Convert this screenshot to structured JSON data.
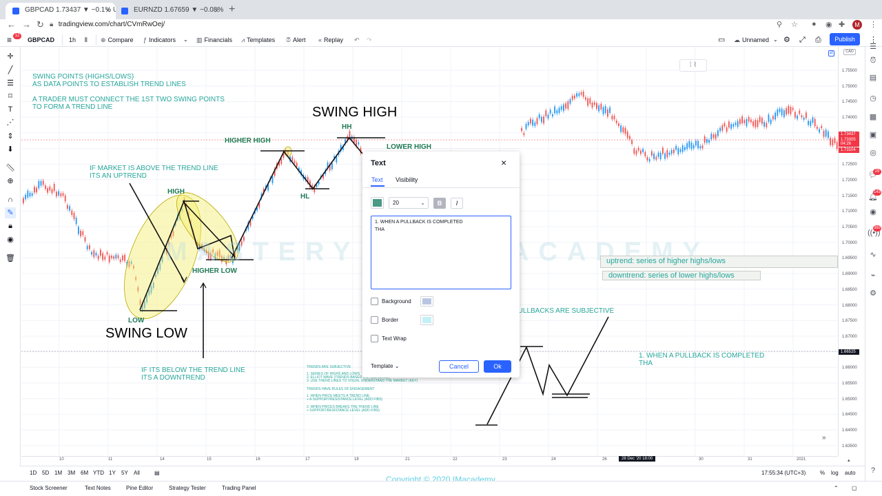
{
  "browser": {
    "tabs": [
      {
        "title": "GBPCAD 1.73437 ▼ −0.1% Un",
        "active": true
      },
      {
        "title": "EURNZD 1.67659 ▼ −0.08% U",
        "active": false
      }
    ],
    "url": "tradingview.com/chart/CVmRwOej/",
    "avatar_letter": "M"
  },
  "toolbar": {
    "symbol": "GBPCAD",
    "interval": "1h",
    "compare": "Compare",
    "indicators": "Indicators",
    "financials": "Financials",
    "templates": "Templates",
    "alert": "Alert",
    "replay": "Replay",
    "layout_name": "Unnamed",
    "publish": "Publish",
    "notif_badge": "12"
  },
  "chart": {
    "currency": "CAD",
    "price_ticks": [
      "1.75500",
      "1.75000",
      "1.74500",
      "1.74000",
      "1.73500",
      "1.73000",
      "1.72500",
      "1.72000",
      "1.71500",
      "1.71000",
      "1.70500",
      "1.70000",
      "1.69500",
      "1.69000",
      "1.68500",
      "1.68000",
      "1.67500",
      "1.67000",
      "1.66500",
      "1.66000",
      "1.65500",
      "1.65000",
      "1.64500",
      "1.64000",
      "1.63500"
    ],
    "price_tags": [
      {
        "text": "1.73437",
        "color": "#f23645"
      },
      {
        "text": "1.73305",
        "color": "#f23645"
      },
      {
        "text": "04:26",
        "color": "#f23645"
      },
      {
        "text": "1.73104",
        "color": "#f23645"
      },
      {
        "text": "1.66525",
        "color": "#131722"
      }
    ],
    "time_ticks": [
      "10",
      "11",
      "14",
      "15",
      "16",
      "17",
      "18",
      "21",
      "22",
      "23",
      "24",
      "26",
      "28 Dec '20   18:00",
      "30",
      "31",
      "2021"
    ],
    "annotations": {
      "swing_points": "SWING POINTS (HIGHS/LOWS)",
      "swing_points2": "AS DATA POINTS TO ESTABLISH TREND LINES",
      "connect": "A TRADER MUST CONNECT THE 1ST TWO SWING POINTS",
      "connect2": "TO FORM A TREND LINE",
      "above": "IF MARKET IS ABOVE THE TREND LINE",
      "above2": "ITS AN UPTREND",
      "high": "HIGH",
      "low": "LOW",
      "swing_low": "SWING LOW",
      "higher_low": "HIGHER LOW",
      "higher_high": "HIGHER HIGH",
      "swing_high": "SWING HIGH",
      "hh": "HH",
      "hl": "HL",
      "lower_high": "LOWER HIGH",
      "below": "IF ITS BELOW THE TREND LINE",
      "below2": "ITS A DOWNTREND",
      "pullbacks": "PULLBACKS ARE SUBJECTIVE",
      "pullback_done": "1. WHEN A PULLBACK IS COMPLETED",
      "pullback_done2": "THA",
      "uptrend_box": "uptrend: series of higher highs/lows",
      "downtrend_box": "downtrend: series of lower highs/lows",
      "watermark_left": "MASTERY",
      "watermark_right": "ACADEMY",
      "small_notes": [
        "TRENDS ARE SUBJECTIVE",
        "1. SERIES OF HIGHS AND LOWS",
        "2. ELLIOT WAVE (TRENDS BASED ON FIBS LEVEL)",
        "3. USE TREND LINES TO VISUAL UNDERSTAND THE MARKET (KEY)",
        "TRENDS HAVE RULES OF ENGAGEMENT",
        "1. WHEN PRICE MEETS A TREND LINE",
        "+ A SUPPORT/RESISTANCE LEVEL (ADD FIBS)",
        "2. WHEN PRICES BREAKS THE TREND LINE",
        "+ SUPPORT/RESISTANCE LEVEL (ADD FIBS)"
      ]
    }
  },
  "dialog": {
    "title": "Text",
    "tab_text": "Text",
    "tab_visibility": "Visibility",
    "color": "#4a9a85",
    "font_size": "20",
    "bold": "B",
    "italic": "I",
    "text_line1": "1. WHEN A PULLBACK IS COMPLETED",
    "text_line2": "THA",
    "background_label": "Background",
    "background_color": "#b9c6e2",
    "border_label": "Border",
    "border_color": "#c3f1f7",
    "wrap_label": "Text Wrap",
    "template": "Template",
    "cancel": "Cancel",
    "ok": "Ok"
  },
  "bottom": {
    "ranges": [
      "1D",
      "5D",
      "1M",
      "3M",
      "6M",
      "YTD",
      "1Y",
      "5Y",
      "All"
    ],
    "clock": "17:55:34 (UTC+3)",
    "pct": "%",
    "log": "log",
    "auto": "auto",
    "copyright": "Copyright © 2020 IMacademy",
    "panels": [
      "Stock Screener",
      "Text Notes",
      "Pine Editor",
      "Strategy Tester",
      "Trading Panel"
    ]
  }
}
